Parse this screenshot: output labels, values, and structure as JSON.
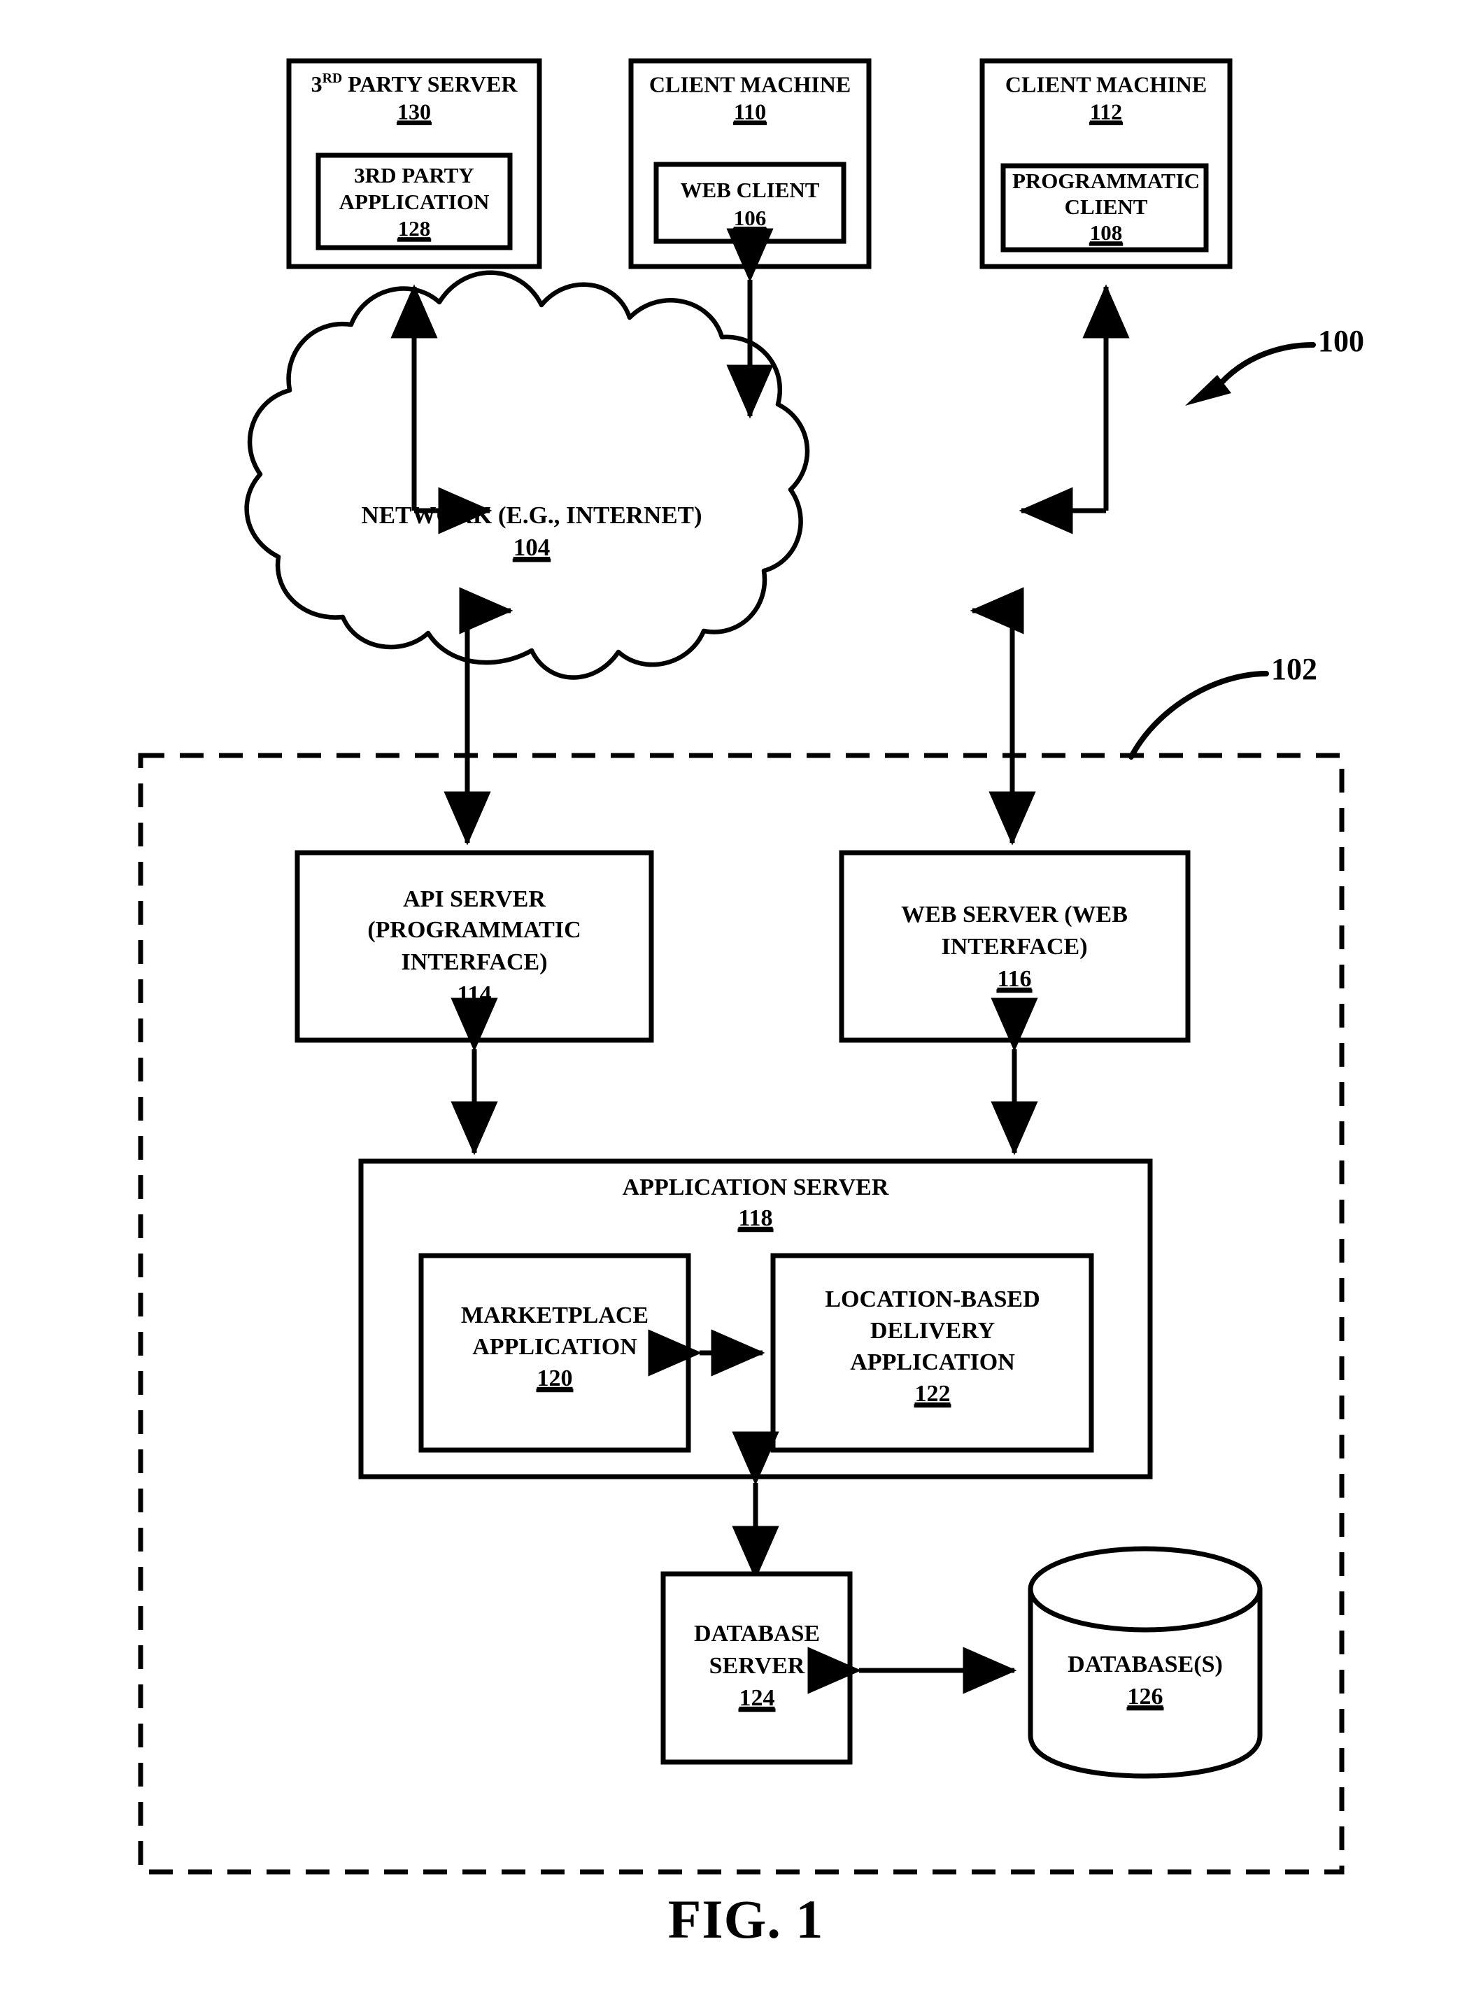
{
  "figure": {
    "caption": "FIG. 1",
    "system_callout": "100",
    "platform_callout": "102"
  },
  "nodes": {
    "third_party_server": {
      "title_prefix": "3",
      "title_sup": "RD",
      "title_rest": " PARTY SERVER",
      "title_plain": "3RD PARTY SERVER",
      "ref": "130"
    },
    "third_party_application": {
      "line1": "3RD PARTY",
      "line2": "APPLICATION",
      "ref": "128"
    },
    "client_machine_110": {
      "title": "CLIENT MACHINE",
      "ref": "110"
    },
    "web_client": {
      "title": "WEB CLIENT",
      "ref": "106"
    },
    "client_machine_112": {
      "title": "CLIENT MACHINE",
      "ref": "112"
    },
    "programmatic_client": {
      "line1": "PROGRAMMATIC",
      "line2": "CLIENT",
      "ref": "108"
    },
    "network": {
      "title": "NETWORK (E.G., INTERNET)",
      "ref": "104"
    },
    "api_server": {
      "line1": "API SERVER",
      "line2": "(PROGRAMMATIC",
      "line3": "INTERFACE)",
      "ref": "114"
    },
    "web_server": {
      "line1": "WEB SERVER (WEB",
      "line2": "INTERFACE)",
      "ref": "116"
    },
    "application_server": {
      "title": "APPLICATION SERVER",
      "ref": "118"
    },
    "marketplace_application": {
      "line1": "MARKETPLACE",
      "line2": "APPLICATION",
      "ref": "120"
    },
    "location_based_delivery_application": {
      "line1": "LOCATION-BASED",
      "line2": "DELIVERY",
      "line3": "APPLICATION",
      "ref": "122"
    },
    "database_server": {
      "line1": "DATABASE",
      "line2": "SERVER",
      "ref": "124"
    },
    "databases": {
      "title": "DATABASE(S)",
      "ref": "126"
    }
  },
  "colors": {
    "stroke": "#000000",
    "background": "#ffffff"
  }
}
